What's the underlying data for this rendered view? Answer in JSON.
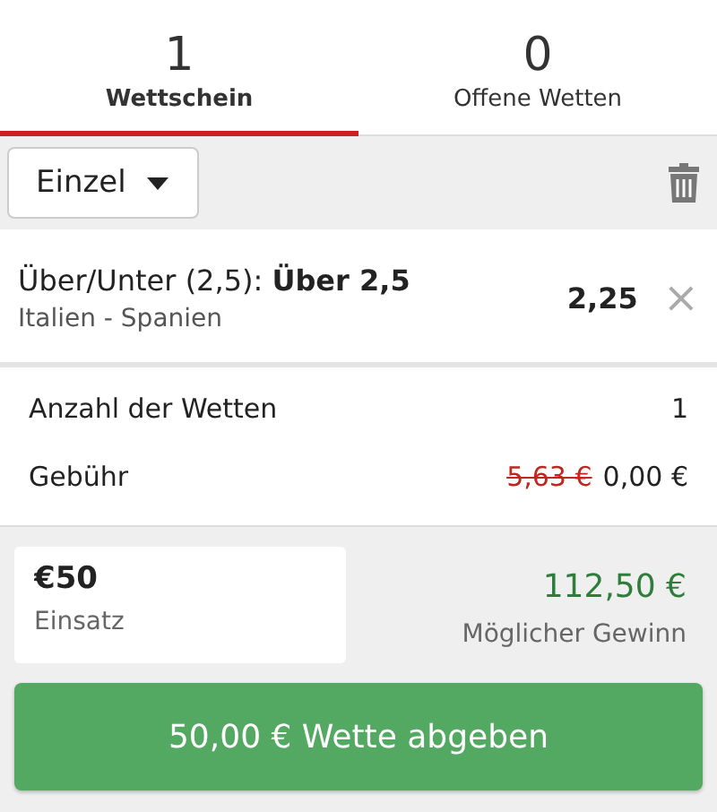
{
  "tabs": [
    {
      "count": "1",
      "label": "Wettschein",
      "selected": true
    },
    {
      "count": "0",
      "label": "Offene Wetten",
      "selected": false
    }
  ],
  "toolbar": {
    "bet_type": "Einzel"
  },
  "selections": [
    {
      "market": "Über/Unter (2,5): **Über 2,5**",
      "event": "Italien - Spanien",
      "odds": "2,25",
      "remove": "×"
    }
  ],
  "summary": {
    "bet_count_label": "Anzahl der Wetten",
    "bet_count": "1",
    "fee_label": "Gebühr",
    "old_fee": "5,63 €",
    "fee": "0,00 €"
  },
  "stake": {
    "value": "€50",
    "label": "Einsatz"
  },
  "potential_win": {
    "amount": "112,50 €",
    "label": "Möglicher Gewinn"
  },
  "submit_button": "50,00 € Wette abgeben"
}
